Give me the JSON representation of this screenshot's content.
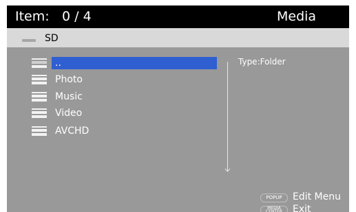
{
  "header": {
    "item_label": "Item:",
    "item_count": "0 / 4",
    "title": "Media"
  },
  "location": {
    "icon": "drive-icon",
    "label": "SD"
  },
  "file_list": {
    "items": [
      {
        "label": "..",
        "icon": "folder-up-icon",
        "selected": true
      },
      {
        "label": "Photo",
        "icon": "folder-icon",
        "selected": false
      },
      {
        "label": "Music",
        "icon": "folder-icon",
        "selected": false
      },
      {
        "label": "Video",
        "icon": "folder-icon",
        "selected": false
      },
      {
        "label": "AVCHD",
        "icon": "folder-icon",
        "selected": false
      }
    ]
  },
  "info_panel": {
    "type_text": "Type:Folder"
  },
  "hints": [
    {
      "key": "POPUP",
      "label": "Edit Menu"
    },
    {
      "key": "MEDIA CENTER",
      "label": "Exit"
    }
  ],
  "colors": {
    "header_bg": "#000000",
    "location_bg": "#d9d9d9",
    "screen_bg": "#999999",
    "selection": "#2f5fd0",
    "text": "#ffffff"
  }
}
